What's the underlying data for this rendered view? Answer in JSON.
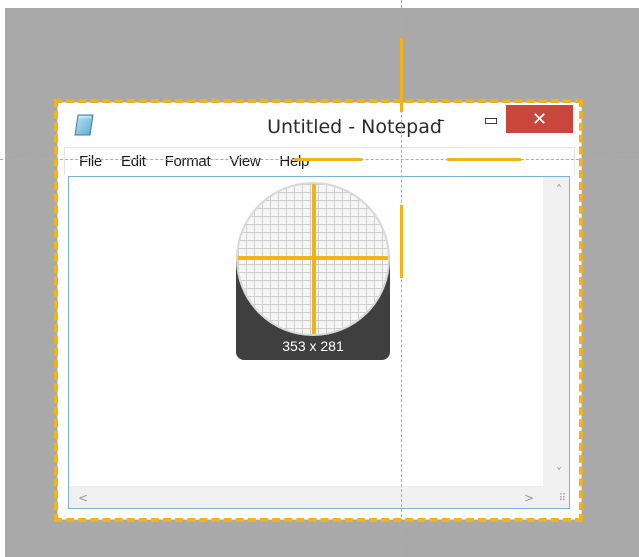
{
  "window": {
    "title": "Untitled - Notepad",
    "min_glyph": "–",
    "max_glyph": "▭",
    "close_glyph": "✕"
  },
  "menu": {
    "items": [
      {
        "label": "File"
      },
      {
        "label": "Edit"
      },
      {
        "label": "Format"
      },
      {
        "label": "View"
      },
      {
        "label": "Help"
      }
    ]
  },
  "editor": {
    "content": ""
  },
  "scrollbars": {
    "up": "˄",
    "down": "˅",
    "left": "<",
    "right": ">"
  },
  "capture": {
    "readout": "353 x 281",
    "accent_color": "#f2b319"
  },
  "colors": {
    "desktop": "#a9a9a9",
    "close_button": "#c9463d",
    "editor_border": "#7fb0dc"
  }
}
